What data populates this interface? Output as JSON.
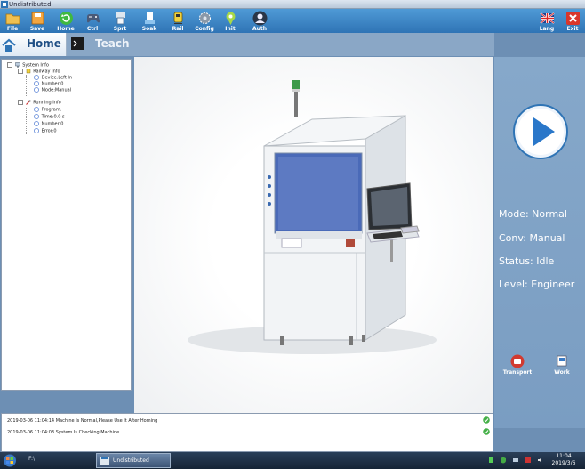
{
  "window": {
    "title": "Undistributed"
  },
  "toolbar": {
    "items": [
      {
        "name": "file-button",
        "label": "File",
        "icon": "folder-icon"
      },
      {
        "name": "save-button",
        "label": "Save",
        "icon": "save-icon"
      },
      {
        "name": "home-toolbar-button",
        "label": "Home",
        "icon": "refresh-icon"
      },
      {
        "name": "ctrl-button",
        "label": "Ctrl",
        "icon": "gamepad-icon"
      },
      {
        "name": "sprt-button",
        "label": "Sprt",
        "icon": "printer-icon"
      },
      {
        "name": "soak-button",
        "label": "Soak",
        "icon": "soak-icon"
      },
      {
        "name": "rail-button",
        "label": "Rail",
        "icon": "rail-icon"
      },
      {
        "name": "config-button",
        "label": "Config",
        "icon": "gear-icon"
      },
      {
        "name": "init-button",
        "label": "Init",
        "icon": "pin-icon"
      },
      {
        "name": "auth-button",
        "label": "Auth",
        "icon": "user-icon"
      }
    ],
    "lang_label": "Lang",
    "exit_label": "Exit"
  },
  "tabs": {
    "home": "Home",
    "teach": "Teach"
  },
  "tree": {
    "root": "System Info",
    "railway": "Railway Info",
    "railway_items": [
      "Device:Left In",
      "Number:0",
      "Mode:Manual"
    ],
    "running": "Running Info",
    "running_items": [
      "Program:",
      "Time:0.0 s",
      "Number:0",
      "Error:0"
    ]
  },
  "status": {
    "mode": "Mode: Normal",
    "conv": "Conv: Manual",
    "status": "Status: Idle",
    "level": "Level: Engineer"
  },
  "right_buttons": {
    "transport": "Transport",
    "work": "Work"
  },
  "log": [
    "2019-03-06 11:04:14   Machine Is Normal,Please Use It After Homing",
    "2019-03-06 11:04:03   System Is Checking Machine ......"
  ],
  "taskbar": {
    "task_label": "Undistributed",
    "quick": "F:\\",
    "time": "11:04",
    "date": "2019/3/6"
  },
  "colors": {
    "toolbar": "#3a82c4",
    "panel": "#7fa2c6",
    "accent": "#2a77c9"
  }
}
